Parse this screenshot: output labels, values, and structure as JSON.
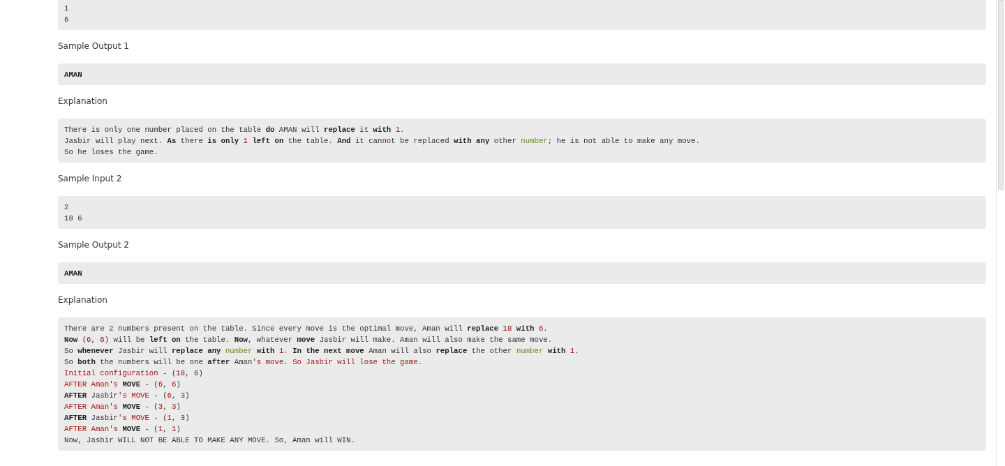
{
  "sections": [
    {
      "kind": "code",
      "lines": [
        [
          {
            "text": "1",
            "kind": "plain"
          }
        ],
        [
          {
            "text": "6",
            "kind": "plain"
          }
        ]
      ]
    },
    {
      "kind": "heading",
      "text": "Sample Output 1"
    },
    {
      "kind": "code",
      "lines": [
        [
          {
            "text": "AMAN",
            "kind": "bold"
          }
        ]
      ]
    },
    {
      "kind": "heading",
      "text": "Explanation"
    },
    {
      "kind": "code",
      "lines": [
        [
          {
            "text": "There is only one number placed on the table ",
            "kind": "plain"
          },
          {
            "text": "do",
            "kind": "bold"
          },
          {
            "text": " AMAN will ",
            "kind": "plain"
          },
          {
            "text": "replace",
            "kind": "bold"
          },
          {
            "text": " it ",
            "kind": "plain"
          },
          {
            "text": "with",
            "kind": "bold"
          },
          {
            "text": " 1",
            "kind": "number"
          },
          {
            "text": ".",
            "kind": "plain"
          }
        ],
        [
          {
            "text": "Jasbir will play next. ",
            "kind": "plain"
          },
          {
            "text": "As",
            "kind": "bold"
          },
          {
            "text": " there ",
            "kind": "plain"
          },
          {
            "text": "is only",
            "kind": "bold"
          },
          {
            "text": " 1",
            "kind": "number"
          },
          {
            "text": " left on",
            "kind": "bold"
          },
          {
            "text": " the table. ",
            "kind": "plain"
          },
          {
            "text": "And",
            "kind": "bold"
          },
          {
            "text": " it cannot be replaced ",
            "kind": "plain"
          },
          {
            "text": "with any",
            "kind": "bold"
          },
          {
            "text": " other ",
            "kind": "plain"
          },
          {
            "text": "number",
            "kind": "type"
          },
          {
            "text": "; he is not able to make any move.",
            "kind": "plain"
          }
        ],
        [
          {
            "text": "So he loses the game.",
            "kind": "plain"
          }
        ]
      ]
    },
    {
      "kind": "heading",
      "text": "Sample Input 2"
    },
    {
      "kind": "code",
      "lines": [
        [
          {
            "text": "2",
            "kind": "plain"
          }
        ],
        [
          {
            "text": "18 6",
            "kind": "plain"
          }
        ]
      ]
    },
    {
      "kind": "heading",
      "text": "Sample Output 2"
    },
    {
      "kind": "code",
      "lines": [
        [
          {
            "text": "AMAN",
            "kind": "bold"
          }
        ]
      ]
    },
    {
      "kind": "heading",
      "text": "Explanation"
    },
    {
      "kind": "code",
      "lines": [
        [
          {
            "text": "There are 2 numbers present on the table. Since every move is the optimal move, Aman will ",
            "kind": "plain"
          },
          {
            "text": "replace",
            "kind": "bold"
          },
          {
            "text": " 18",
            "kind": "number"
          },
          {
            "text": " with",
            "kind": "bold"
          },
          {
            "text": " 6",
            "kind": "number"
          },
          {
            "text": ".",
            "kind": "plain"
          }
        ],
        [
          {
            "text": "Now",
            "kind": "bold"
          },
          {
            "text": " (",
            "kind": "plain"
          },
          {
            "text": "6",
            "kind": "number"
          },
          {
            "text": ", ",
            "kind": "plain"
          },
          {
            "text": "6",
            "kind": "number"
          },
          {
            "text": ") will be ",
            "kind": "plain"
          },
          {
            "text": "left on",
            "kind": "bold"
          },
          {
            "text": " the table. ",
            "kind": "plain"
          },
          {
            "text": "Now",
            "kind": "bold"
          },
          {
            "text": ", whatever ",
            "kind": "plain"
          },
          {
            "text": "move",
            "kind": "bold"
          },
          {
            "text": " Jasbir will make. Aman will also make the same move.",
            "kind": "plain"
          }
        ],
        [
          {
            "text": "So ",
            "kind": "plain"
          },
          {
            "text": "whenever",
            "kind": "bold"
          },
          {
            "text": " Jasbir will ",
            "kind": "plain"
          },
          {
            "text": "replace any",
            "kind": "bold"
          },
          {
            "text": " number",
            "kind": "type"
          },
          {
            "text": " with",
            "kind": "bold"
          },
          {
            "text": " 1",
            "kind": "number"
          },
          {
            "text": ". ",
            "kind": "plain"
          },
          {
            "text": "In the next move",
            "kind": "bold"
          },
          {
            "text": " Aman will also ",
            "kind": "plain"
          },
          {
            "text": "replace",
            "kind": "bold"
          },
          {
            "text": " the other ",
            "kind": "plain"
          },
          {
            "text": "number",
            "kind": "type"
          },
          {
            "text": " with",
            "kind": "bold"
          },
          {
            "text": " 1",
            "kind": "number"
          },
          {
            "text": ".",
            "kind": "plain"
          }
        ],
        [
          {
            "text": "So ",
            "kind": "plain"
          },
          {
            "text": "both",
            "kind": "bold"
          },
          {
            "text": " the numbers will be one ",
            "kind": "plain"
          },
          {
            "text": "after",
            "kind": "bold"
          },
          {
            "text": " Aman",
            "kind": "plain"
          },
          {
            "text": "'s move. So Jasbir will lose the game.",
            "kind": "string"
          }
        ],
        [
          {
            "text": "Initial configuration",
            "kind": "string"
          },
          {
            "text": " - (",
            "kind": "plain"
          },
          {
            "text": "18",
            "kind": "number"
          },
          {
            "text": ", ",
            "kind": "plain"
          },
          {
            "text": "6",
            "kind": "number"
          },
          {
            "text": ")",
            "kind": "plain"
          }
        ],
        [
          {
            "text": "AFTER Aman's ",
            "kind": "string"
          },
          {
            "text": "MOVE",
            "kind": "bold"
          },
          {
            "text": " - (",
            "kind": "plain"
          },
          {
            "text": "6",
            "kind": "number"
          },
          {
            "text": ", ",
            "kind": "plain"
          },
          {
            "text": "6",
            "kind": "number"
          },
          {
            "text": ")",
            "kind": "plain"
          }
        ],
        [
          {
            "text": "AFTER",
            "kind": "bold"
          },
          {
            "text": " Jasbir",
            "kind": "plain"
          },
          {
            "text": "'s MOVE",
            "kind": "string"
          },
          {
            "text": " - (",
            "kind": "plain"
          },
          {
            "text": "6",
            "kind": "number"
          },
          {
            "text": ", ",
            "kind": "plain"
          },
          {
            "text": "3",
            "kind": "number"
          },
          {
            "text": ")",
            "kind": "plain"
          }
        ],
        [
          {
            "text": "AFTER Aman's ",
            "kind": "string"
          },
          {
            "text": "MOVE",
            "kind": "bold"
          },
          {
            "text": " - (",
            "kind": "plain"
          },
          {
            "text": "3",
            "kind": "number"
          },
          {
            "text": ", ",
            "kind": "plain"
          },
          {
            "text": "3",
            "kind": "number"
          },
          {
            "text": ")",
            "kind": "plain"
          }
        ],
        [
          {
            "text": "AFTER",
            "kind": "bold"
          },
          {
            "text": " Jasbir",
            "kind": "plain"
          },
          {
            "text": "'s MOVE",
            "kind": "string"
          },
          {
            "text": " - (",
            "kind": "plain"
          },
          {
            "text": "1",
            "kind": "number"
          },
          {
            "text": ", ",
            "kind": "plain"
          },
          {
            "text": "3",
            "kind": "number"
          },
          {
            "text": ")",
            "kind": "plain"
          }
        ],
        [
          {
            "text": "AFTER Aman's ",
            "kind": "string"
          },
          {
            "text": "MOVE",
            "kind": "bold"
          },
          {
            "text": " - (",
            "kind": "plain"
          },
          {
            "text": "1",
            "kind": "number"
          },
          {
            "text": ", ",
            "kind": "plain"
          },
          {
            "text": "1",
            "kind": "number"
          },
          {
            "text": ")",
            "kind": "plain"
          }
        ],
        [
          {
            "text": "Now, Jasbir WILL NOT BE ABLE TO MAKE ANY MOVE. So, Aman will WIN.",
            "kind": "plain"
          }
        ]
      ]
    }
  ]
}
